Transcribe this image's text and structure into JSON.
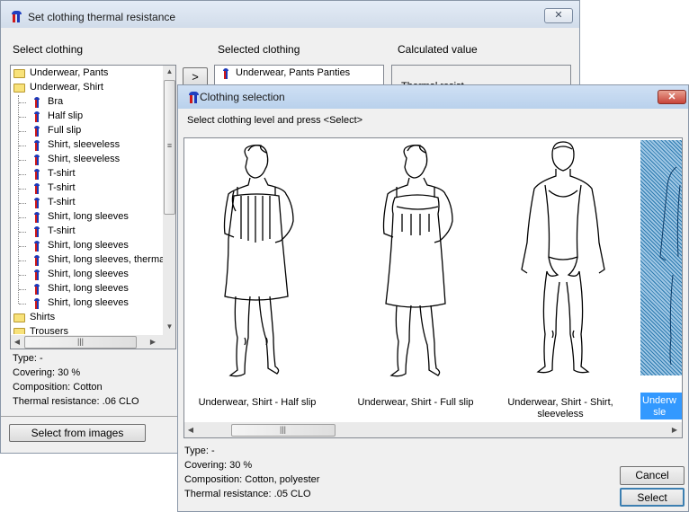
{
  "main_window": {
    "title": "Set clothing thermal resistance",
    "close_label": "✕",
    "select_label": "Select clothing",
    "selected_label": "Selected clothing",
    "calculated_label": "Calculated value",
    "move_button": ">",
    "tree": [
      {
        "type": "folder",
        "label": "Underwear, Pants"
      },
      {
        "type": "folder",
        "label": "Underwear, Shirt"
      },
      {
        "type": "item",
        "label": "Bra"
      },
      {
        "type": "item",
        "label": "Half slip"
      },
      {
        "type": "item",
        "label": "Full slip"
      },
      {
        "type": "item",
        "label": "Shirt, sleeveless"
      },
      {
        "type": "item",
        "label": "Shirt, sleeveless"
      },
      {
        "type": "item",
        "label": "T-shirt"
      },
      {
        "type": "item",
        "label": "T-shirt"
      },
      {
        "type": "item",
        "label": "T-shirt"
      },
      {
        "type": "item",
        "label": "Shirt, long sleeves"
      },
      {
        "type": "item",
        "label": "T-shirt"
      },
      {
        "type": "item",
        "label": "Shirt, long sleeves"
      },
      {
        "type": "item",
        "label": "Shirt, long sleeves, thermal"
      },
      {
        "type": "item",
        "label": "Shirt, long sleeves"
      },
      {
        "type": "item",
        "label": "Shirt, long sleeves"
      },
      {
        "type": "item",
        "label": "Shirt, long sleeves"
      },
      {
        "type": "folder",
        "label": "Shirts"
      },
      {
        "type": "folder",
        "label": "Trousers"
      }
    ],
    "selected_items": [
      "Underwear, Pants Panties"
    ],
    "calc_partial": "Thermal resist",
    "info": {
      "type": "Type: -",
      "covering": "Covering: 30 %",
      "composition": "Composition: Cotton",
      "thermal": "Thermal resistance: .06 CLO"
    },
    "select_images_button": "Select from images"
  },
  "dialog": {
    "title": "Clothing selection",
    "close_label": "✕",
    "instruction": "Select clothing level and press <Select>",
    "images": [
      {
        "caption": "Underwear, Shirt - Half slip",
        "icon": "half-slip-figure"
      },
      {
        "caption": "Underwear, Shirt - Full slip",
        "icon": "full-slip-figure"
      },
      {
        "caption": "Underwear, Shirt - Shirt, sleeveless",
        "icon": "sleeveless-shirt-figure"
      },
      {
        "caption": "Underwear, Shirt - Shirt, sleeveless",
        "icon": "sleeveless-shirt-figure",
        "selected": true
      }
    ],
    "selected_caption_visible": "Underw\nsle",
    "info": {
      "type": "Type: -",
      "covering": "Covering: 30 %",
      "composition": "Composition: Cotton, polyester",
      "thermal": "Thermal resistance: .05 CLO"
    },
    "cancel_button": "Cancel",
    "select_button": "Select",
    "accent": "#3399ff"
  }
}
